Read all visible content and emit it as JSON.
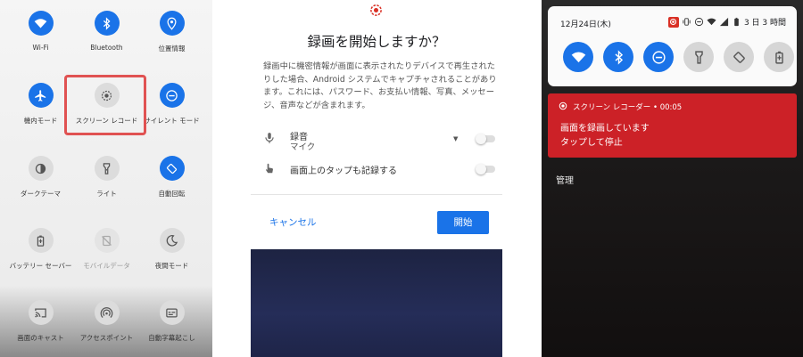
{
  "quick_settings": {
    "tiles": [
      {
        "label": "Wi-Fi",
        "icon": "wifi-icon",
        "state": "on"
      },
      {
        "label": "Bluetooth",
        "icon": "bluetooth-icon",
        "state": "on"
      },
      {
        "label": "位置情報",
        "icon": "location-icon",
        "state": "on"
      },
      {
        "label": "機内モード",
        "icon": "airplane-icon",
        "state": "on"
      },
      {
        "label": "スクリーン レコード",
        "icon": "screen-record-icon",
        "state": "off"
      },
      {
        "label": "サイレント モード",
        "icon": "do-not-disturb-icon",
        "state": "on"
      },
      {
        "label": "ダークテーマ",
        "icon": "dark-theme-icon",
        "state": "off"
      },
      {
        "label": "ライト",
        "icon": "flashlight-icon",
        "state": "off"
      },
      {
        "label": "自動回転",
        "icon": "auto-rotate-icon",
        "state": "on"
      },
      {
        "label": "バッテリー セーバー",
        "icon": "battery-saver-icon",
        "state": "off"
      },
      {
        "label": "モバイルデータ",
        "icon": "mobile-data-off-icon",
        "state": "disabled"
      },
      {
        "label": "夜間モード",
        "icon": "night-mode-icon",
        "state": "off"
      },
      {
        "label": "画面のキャスト",
        "icon": "cast-icon",
        "state": "off"
      },
      {
        "label": "アクセスポイント",
        "icon": "hotspot-icon",
        "state": "off"
      },
      {
        "label": "自動字幕起こし",
        "icon": "live-caption-icon",
        "state": "off"
      }
    ],
    "highlight_color": "#e05252"
  },
  "dialog": {
    "title": "録画を開始しますか？",
    "body": "録画中に機密情報が画面に表示されたりデバイスで再生されたりした場合、Android システムでキャプチャされることがあります。これには、パスワード、お支払い情報、写真、メッセージ、音声などが含まれます。",
    "audio_label": "録音",
    "audio_source": "マイク",
    "taps_label": "画面上のタップも記録する",
    "cancel_label": "キャンセル",
    "start_label": "開始",
    "accent": "#1a73e8"
  },
  "shade": {
    "date": "12月24日(木)",
    "battery": "3 日 3 時間",
    "notification": {
      "title": "スクリーン レコーダー • 00:05",
      "line1": "画面を録画しています",
      "line2": "タップして停止",
      "color": "#cc2127"
    },
    "manage_label": "管理"
  }
}
